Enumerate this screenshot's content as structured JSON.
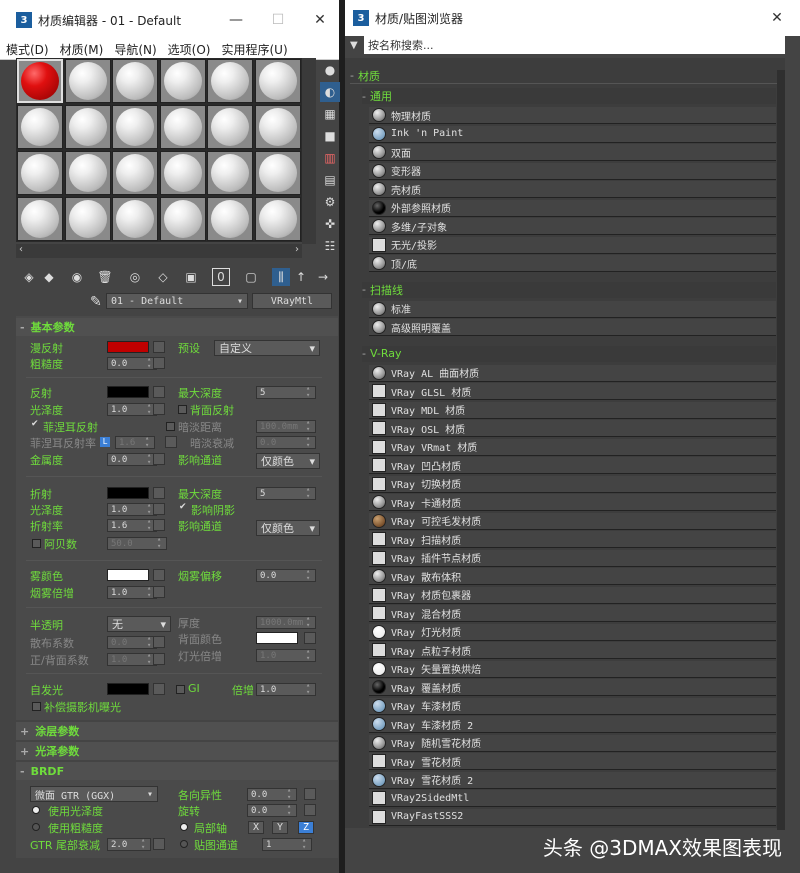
{
  "material_editor": {
    "title": "材质编辑器 - 01 - Default",
    "menu": [
      "模式(D)",
      "材质(M)",
      "导航(N)",
      "选项(O)",
      "实用程序(U)"
    ],
    "material_name": "01 - Default",
    "material_type": "VRayMtl",
    "rollouts": {
      "basic": "基本参数",
      "coat": "涂层参数",
      "sheen": "光泽参数",
      "brdf": "BRDF"
    },
    "basic": {
      "diffuse_label": "漫反射",
      "roughness_label": "粗糙度",
      "roughness": "0.0",
      "preset_label": "预设",
      "preset": "自定义",
      "reflect_label": "反射",
      "max_depth_label": "最大深度",
      "reflect_max_depth": "5",
      "gloss_label": "光泽度",
      "gloss": "1.0",
      "back_reflect": "背面反射",
      "fresnel": "菲涅耳反射",
      "dim_distance": "暗淡距离",
      "dim_distance_val": "100.0mm",
      "fresnel_ior_label": "菲涅耳反射率",
      "fresnel_ior": "1.6",
      "dim_falloff": "暗淡衰减",
      "dim_falloff_val": "0.0",
      "metal_label": "金属度",
      "metal": "0.0",
      "affect_channel_label": "影响通道",
      "affect_channel": "仅颜色",
      "refract_label": "折射",
      "refract_max_depth_label": "最大深度",
      "refract_max_depth": "5",
      "refract_gloss_label": "光泽度",
      "refract_gloss": "1.0",
      "affect_shadows": "影响阴影",
      "ior_label": "折射率",
      "ior": "1.6",
      "refract_affect_channel_label": "影响通道",
      "refract_affect_channel": "仅颜色",
      "abbe_label": "阿贝数",
      "abbe": "50.0",
      "fog_color_label": "雾颜色",
      "fog_bias_label": "烟雾偏移",
      "fog_bias": "0.0",
      "fog_mult_label": "烟雾倍增",
      "fog_mult": "1.0",
      "translucency_label": "半透明",
      "translucency": "无",
      "thickness_label": "厚度",
      "thickness": "1000.0mm",
      "scatter_label": "散布系数",
      "scatter": "0.0",
      "back_color_label": "背面颜色",
      "fb_label": "正/背面系数",
      "fb": "1.0",
      "light_mult_label": "灯光倍增",
      "light_mult": "1.0",
      "self_illum_label": "自发光",
      "gi_label": "GI",
      "mult_label": "倍增",
      "mult": "1.0",
      "compensate": "补偿摄影机曝光"
    },
    "brdf": {
      "type": "微面 GTR (GGX)",
      "anisotropy_label": "各向异性",
      "anisotropy": "0.0",
      "use_gloss": "使用光泽度",
      "rotation_label": "旋转",
      "rotation": "0.0",
      "use_rough": "使用粗糙度",
      "local_axis": "局部轴",
      "axes": [
        "X",
        "Y",
        "Z"
      ],
      "gtr_tail_label": "GTR 尾部衰减",
      "gtr_tail": "2.0",
      "map_channel": "贴图通道",
      "map_channel_val": "1"
    },
    "colors": {
      "diffuse": "#c00000",
      "reflect": "#000000",
      "refract": "#000000",
      "fog": "#ffffff",
      "back": "#ffffff",
      "self_illum": "#000000",
      "accent": "#6fdc3c"
    }
  },
  "browser": {
    "title": "材质/贴图浏览器",
    "search_placeholder": "按名称搜索...",
    "root": "材质",
    "groups": [
      {
        "name": "通用",
        "items": [
          {
            "label": "物理材质",
            "icon": "sphere"
          },
          {
            "label": "Ink 'n Paint",
            "icon": "blue"
          },
          {
            "label": "双面",
            "icon": "sphere"
          },
          {
            "label": "变形器",
            "icon": "sphere"
          },
          {
            "label": "壳材质",
            "icon": "sphere"
          },
          {
            "label": "外部参照材质",
            "icon": "black"
          },
          {
            "label": "多维/子对象",
            "icon": "sphere"
          },
          {
            "label": "无光/投影",
            "icon": "flat"
          },
          {
            "label": "顶/底",
            "icon": "sphere"
          }
        ]
      },
      {
        "name": "扫描线",
        "items": [
          {
            "label": "标准",
            "icon": "sphere"
          },
          {
            "label": "高级照明覆盖",
            "icon": "sphere"
          }
        ]
      },
      {
        "name": "V-Ray",
        "items": [
          {
            "label": "VRay AL 曲面材质",
            "icon": "sphere"
          },
          {
            "label": "VRay GLSL 材质",
            "icon": "flat"
          },
          {
            "label": "VRay MDL 材质",
            "icon": "flat"
          },
          {
            "label": "VRay OSL 材质",
            "icon": "flat"
          },
          {
            "label": "VRay VRmat 材质",
            "icon": "flat"
          },
          {
            "label": "VRay 凹凸材质",
            "icon": "flat"
          },
          {
            "label": "VRay 切换材质",
            "icon": "flat"
          },
          {
            "label": "VRay 卡通材质",
            "icon": "sphere"
          },
          {
            "label": "VRay 可控毛发材质",
            "icon": "brown"
          },
          {
            "label": "VRay 扫描材质",
            "icon": "flat"
          },
          {
            "label": "VRay 插件节点材质",
            "icon": "flat"
          },
          {
            "label": "VRay 散布体积",
            "icon": "sphere"
          },
          {
            "label": "VRay 材质包裹器",
            "icon": "flat"
          },
          {
            "label": "VRay 混合材质",
            "icon": "flat"
          },
          {
            "label": "VRay 灯光材质",
            "icon": "light"
          },
          {
            "label": "VRay 点粒子材质",
            "icon": "flat"
          },
          {
            "label": "VRay 矢量置换烘焙",
            "icon": "light"
          },
          {
            "label": "VRay 覆盖材质",
            "icon": "black"
          },
          {
            "label": "VRay 车漆材质",
            "icon": "blue"
          },
          {
            "label": "VRay 车漆材质 2",
            "icon": "blue"
          },
          {
            "label": "VRay 随机雪花材质",
            "icon": "sphere"
          },
          {
            "label": "VRay 雪花材质",
            "icon": "flat"
          },
          {
            "label": "VRay 雪花材质 2",
            "icon": "blue"
          },
          {
            "label": "VRay2SidedMtl",
            "icon": "flat"
          },
          {
            "label": "VRayFastSSS2",
            "icon": "flat"
          }
        ]
      }
    ]
  },
  "watermark": "头条 @3DMAX效果图表现"
}
